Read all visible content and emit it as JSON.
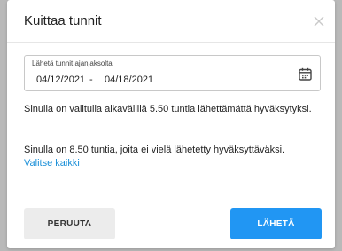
{
  "modal": {
    "title": "Kuittaa tunnit",
    "close_icon": "close-icon"
  },
  "date_range": {
    "label": "Lähetä tunnit ajanjaksolta",
    "start": "04/12/2021",
    "separator": "-",
    "end": "04/18/2021",
    "icon": "calendar-icon"
  },
  "messages": {
    "unsent": "Sinulla on valitulla aikavälillä 5.50 tuntia lähettämättä hyväksytyksi.",
    "pending": "Sinulla on 8.50 tuntia, joita ei vielä lähetetty hyväksyttäväksi.",
    "select_all_link": "Valitse kaikki"
  },
  "buttons": {
    "cancel": "PERUUTA",
    "send": "LÄHETÄ"
  },
  "colors": {
    "accent": "#2196f3",
    "link": "#1a8fd8",
    "cancel_bg": "#ececec",
    "backdrop": "#b9b9b9"
  }
}
